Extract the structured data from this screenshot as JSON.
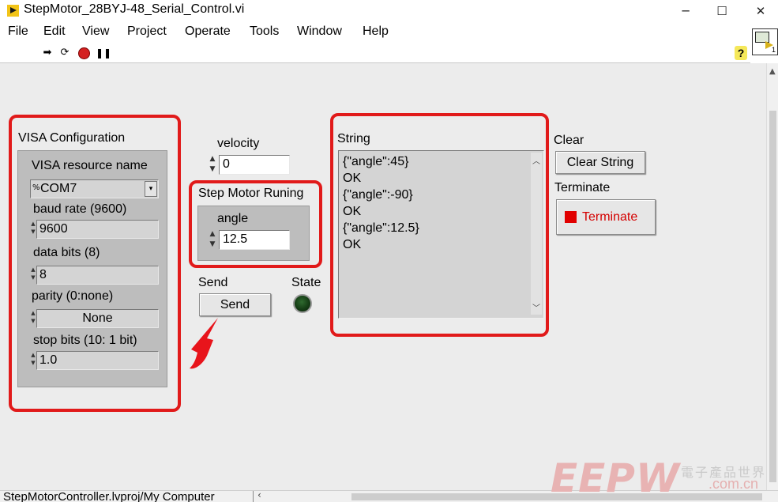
{
  "window": {
    "title": "StepMotor_28BYJ-48_Serial_Control.vi",
    "minimize": "─",
    "maximize": "☐",
    "close": "✕"
  },
  "menu": [
    "File",
    "Edit",
    "View",
    "Project",
    "Operate",
    "Tools",
    "Window",
    "Help"
  ],
  "toolbar": {
    "icons": [
      "run-arrow-icon",
      "run-continuously-icon",
      "abort-icon",
      "pause-icon"
    ],
    "help": "?"
  },
  "vi_icon": {
    "number": "1"
  },
  "visa": {
    "title": "VISA Configuration",
    "resource_label": "VISA resource name",
    "resource_value": "COM7",
    "baud_label": "baud rate (9600)",
    "baud_value": "9600",
    "databits_label": "data bits (8)",
    "databits_value": "8",
    "parity_label": "parity (0:none)",
    "parity_value": "None",
    "stopbits_label": "stop bits (10: 1 bit)",
    "stopbits_value": "1.0"
  },
  "velocity": {
    "label": "velocity",
    "value": "0"
  },
  "stepmotor": {
    "title": "Step Motor Runing",
    "angle_label": "angle",
    "angle_value": "12.5"
  },
  "send": {
    "label": "Send",
    "button": "Send"
  },
  "state": {
    "label": "State"
  },
  "string": {
    "label": "String",
    "lines": [
      "{\"angle\":45}",
      "OK",
      "{\"angle\":-90}",
      "OK",
      "{\"angle\":12.5}",
      "OK"
    ]
  },
  "clear": {
    "label": "Clear",
    "button": "Clear String"
  },
  "terminate": {
    "label": "Terminate",
    "button": "Terminate"
  },
  "status_bar": {
    "path": "StepMotorController.lvproj/My Computer"
  },
  "watermark": {
    "brand": "EEPW",
    "cn": "電子產品世界",
    "url": ".com.cn"
  },
  "colors": {
    "highlight": "#e11a1a",
    "panel": "#ececec",
    "stop": "#e10000",
    "led_off": "#1f4d1f"
  }
}
